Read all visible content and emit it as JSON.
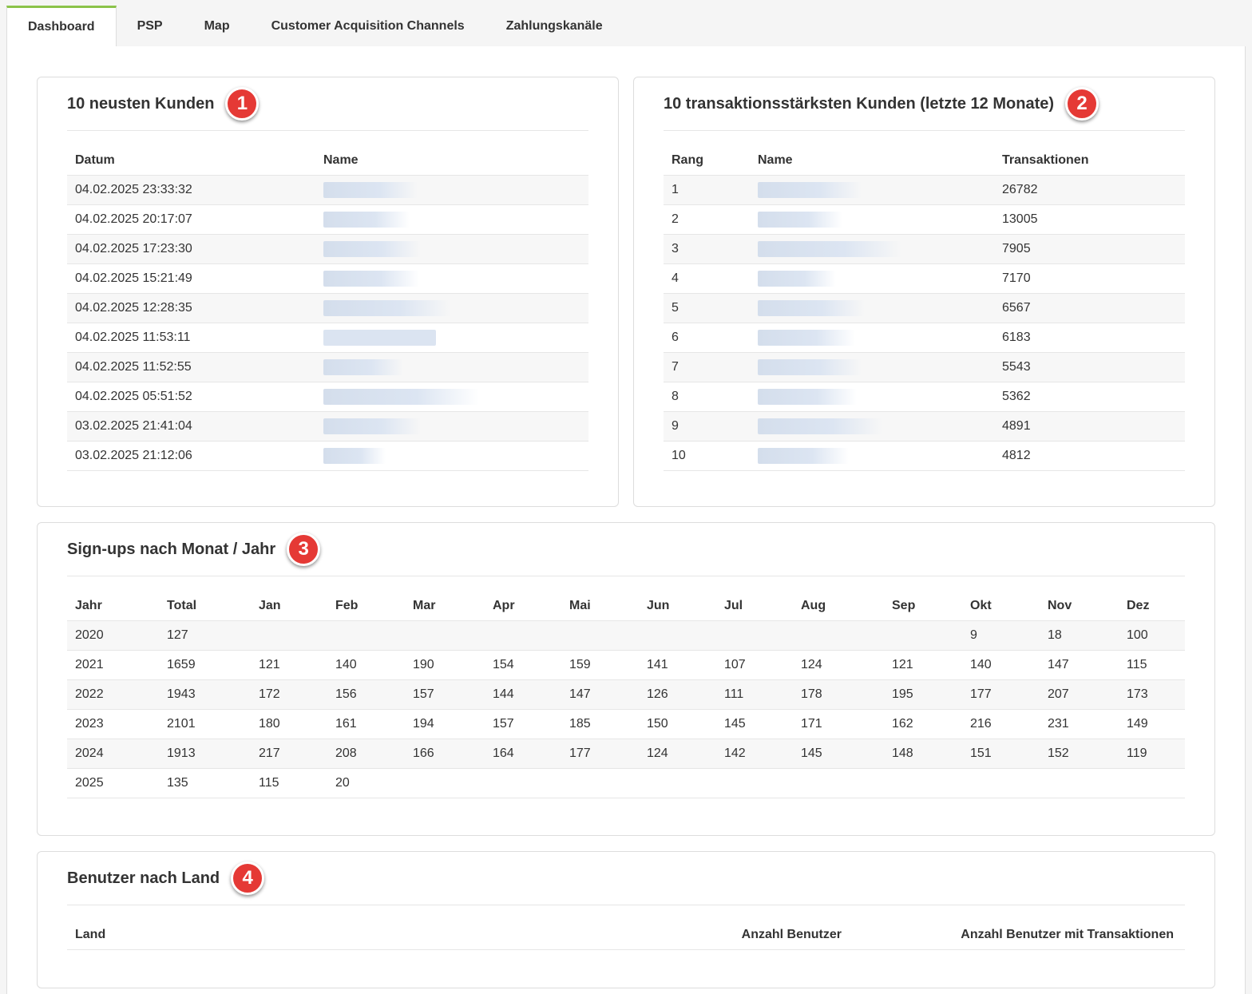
{
  "tabs": [
    "Dashboard",
    "PSP",
    "Map",
    "Customer Acquisition Channels",
    "Zahlungskanäle"
  ],
  "newest": {
    "title": "10 neusten Kunden",
    "badge": "1",
    "headers": [
      "Datum",
      "Name"
    ],
    "rows": [
      "04.02.2025 23:33:32",
      "04.02.2025 20:17:07",
      "04.02.2025 17:23:30",
      "04.02.2025 15:21:49",
      "04.02.2025 12:28:35",
      "04.02.2025 11:53:11",
      "04.02.2025 11:52:55",
      "04.02.2025 05:51:52",
      "03.02.2025 21:41:04",
      "03.02.2025 21:12:06"
    ]
  },
  "top": {
    "title": "10 transaktionsstärksten Kunden (letzte 12 Monate)",
    "badge": "2",
    "headers": [
      "Rang",
      "Name",
      "Transaktionen"
    ],
    "rows": [
      [
        "1",
        "26782"
      ],
      [
        "2",
        "13005"
      ],
      [
        "3",
        "7905"
      ],
      [
        "4",
        "7170"
      ],
      [
        "5",
        "6567"
      ],
      [
        "6",
        "6183"
      ],
      [
        "7",
        "5543"
      ],
      [
        "8",
        "5362"
      ],
      [
        "9",
        "4891"
      ],
      [
        "10",
        "4812"
      ]
    ]
  },
  "signups": {
    "title": "Sign-ups nach Monat / Jahr",
    "badge": "3",
    "headers": [
      "Jahr",
      "Total",
      "Jan",
      "Feb",
      "Mar",
      "Apr",
      "Mai",
      "Jun",
      "Jul",
      "Aug",
      "Sep",
      "Okt",
      "Nov",
      "Dez"
    ],
    "rows": [
      [
        "2020",
        "127",
        "",
        "",
        "",
        "",
        "",
        "",
        "",
        "",
        "",
        "9",
        "18",
        "100"
      ],
      [
        "2021",
        "1659",
        "121",
        "140",
        "190",
        "154",
        "159",
        "141",
        "107",
        "124",
        "121",
        "140",
        "147",
        "115"
      ],
      [
        "2022",
        "1943",
        "172",
        "156",
        "157",
        "144",
        "147",
        "126",
        "111",
        "178",
        "195",
        "177",
        "207",
        "173"
      ],
      [
        "2023",
        "2101",
        "180",
        "161",
        "194",
        "157",
        "185",
        "150",
        "145",
        "171",
        "162",
        "216",
        "231",
        "149"
      ],
      [
        "2024",
        "1913",
        "217",
        "208",
        "166",
        "164",
        "177",
        "124",
        "142",
        "145",
        "148",
        "151",
        "152",
        "119"
      ],
      [
        "2025",
        "135",
        "115",
        "20",
        "",
        "",
        "",
        "",
        "",
        "",
        "",
        "",
        "",
        ""
      ]
    ]
  },
  "countries": {
    "title": "Benutzer nach Land",
    "badge": "4",
    "headers": [
      "Land",
      "Anzahl Benutzer",
      "Anzahl Benutzer mit Transaktionen"
    ]
  }
}
